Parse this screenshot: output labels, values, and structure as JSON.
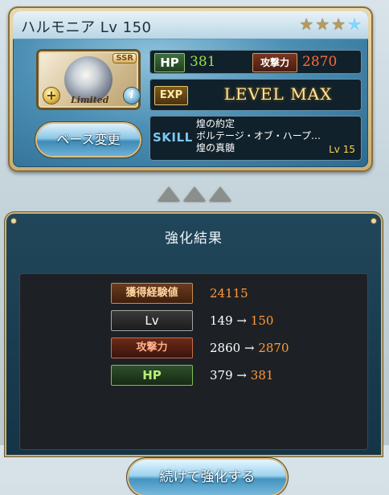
{
  "character": {
    "name": "ハルモニア",
    "level_label": "Lv 150",
    "stars": [
      "filled",
      "filled",
      "filled",
      "blue"
    ],
    "rarity": "SSR",
    "limited_label": "Limited",
    "plus_icon_glyph": "+",
    "info_icon_glyph": "i"
  },
  "stats": {
    "hp_label": "HP",
    "hp_value": "381",
    "atk_label": "攻撃力",
    "atk_value": "2870",
    "exp_label": "EXP",
    "exp_status": "LEVEL MAX"
  },
  "skills": {
    "label": "SKILL",
    "items": [
      "煌の約定",
      "ボルテージ・オブ・ハープ…",
      "煌の真髄"
    ],
    "level": "Lv 15"
  },
  "base_button": {
    "label": "ベース変更"
  },
  "result": {
    "title": "強化結果",
    "rows": [
      {
        "label": "獲得経験値",
        "before": "24115",
        "arrow": "",
        "after": ""
      },
      {
        "label": "Lv",
        "before": "149",
        "arrow": "→",
        "after": "150"
      },
      {
        "label": "攻撃力",
        "before": "2860",
        "arrow": "→",
        "after": "2870"
      },
      {
        "label": "HP",
        "before": "379",
        "arrow": "→",
        "after": "381"
      }
    ],
    "continue_label": "続けて強化する"
  },
  "colors": {
    "hp_green": "#9ddc4f",
    "atk_orange": "#ff6a3a",
    "highlight_orange": "#ff9a3a",
    "skill_level_yellow": "#ffd24a"
  }
}
